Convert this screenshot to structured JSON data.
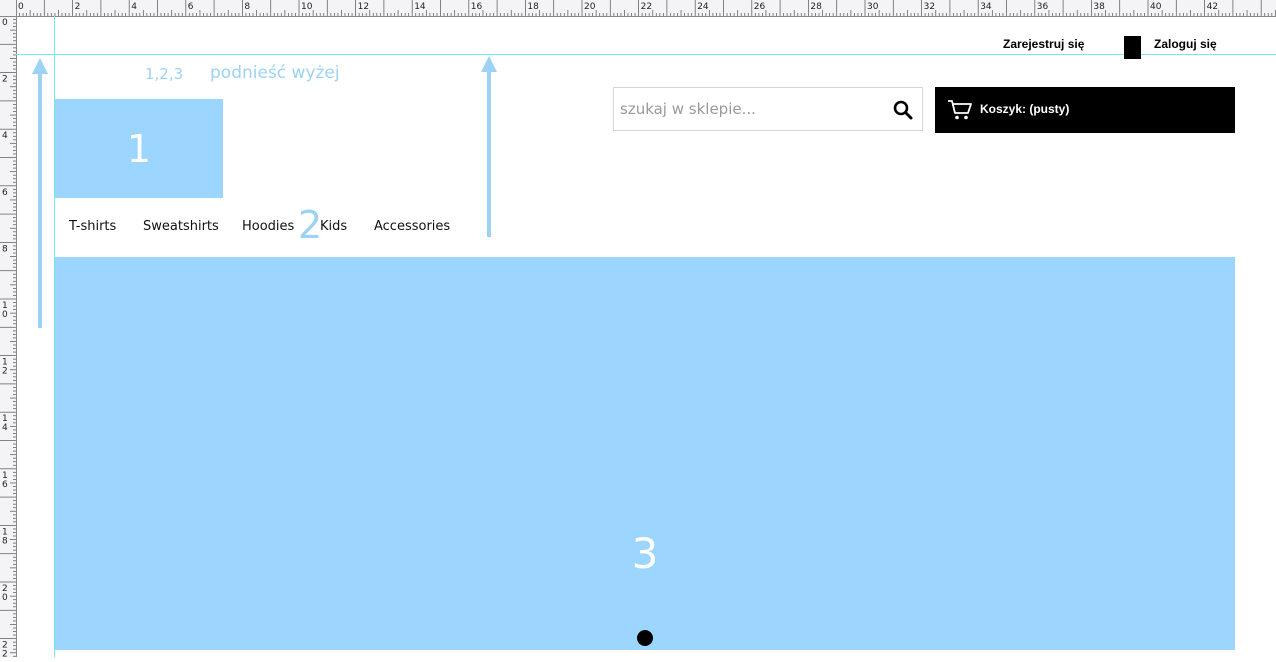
{
  "ruler": {
    "top_labels": [
      "0",
      "2",
      "4",
      "6",
      "8",
      "10",
      "12",
      "14",
      "16",
      "18",
      "20",
      "22",
      "24",
      "26",
      "28",
      "30",
      "32",
      "34",
      "36",
      "38",
      "40",
      "42"
    ],
    "left_labels": [
      "0",
      "2",
      "4",
      "6",
      "8",
      "10",
      "12",
      "14",
      "16",
      "18",
      "20",
      "22"
    ]
  },
  "header": {
    "register_label": "Zarejestruj się",
    "login_label": "Zaloguj się"
  },
  "annotation": {
    "items": "1,2,3",
    "note": "podnieść wyżej"
  },
  "block1": {
    "label": "1"
  },
  "nav": {
    "items": [
      {
        "label": "T-shirts"
      },
      {
        "label": "Sweatshirts"
      },
      {
        "label": "Hoodies"
      },
      {
        "label": "Kids"
      },
      {
        "label": "Accessories"
      }
    ],
    "marker": "2"
  },
  "search": {
    "placeholder": "szukaj w sklepie...",
    "icon": "search-icon"
  },
  "cart": {
    "label": "Koszyk: (pusty)",
    "icon": "cart-icon"
  },
  "block3": {
    "label": "3"
  },
  "colors": {
    "placeholder_blue": "#9cd5fd",
    "guide_cyan": "#78e6ea",
    "cart_bg": "#000000"
  }
}
